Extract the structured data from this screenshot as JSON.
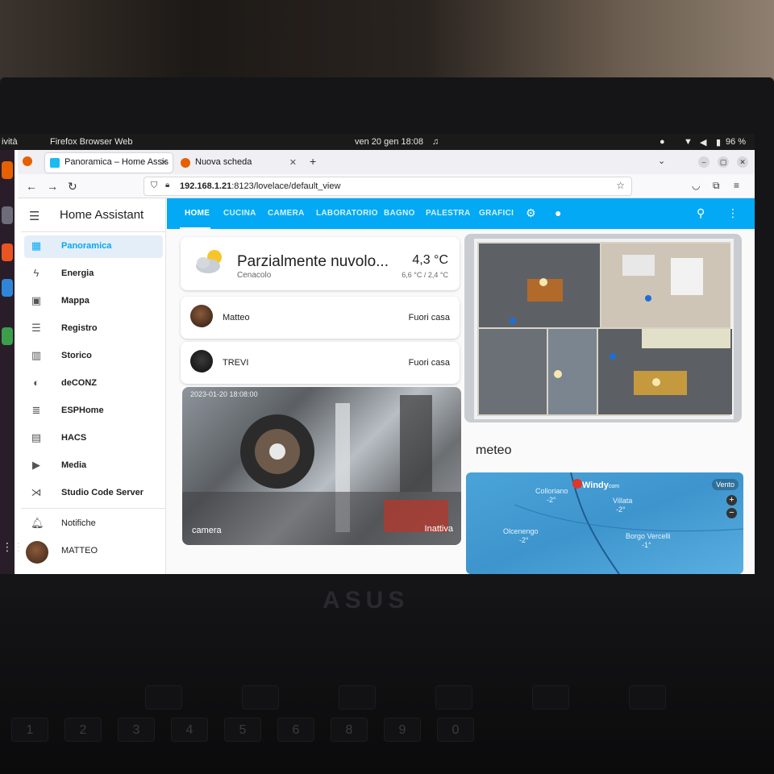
{
  "gnome": {
    "activities": "ività",
    "app_name": "Firefox Browser Web",
    "clock": "ven 20 gen  18:08",
    "battery": "96 %"
  },
  "browser": {
    "tabs": [
      {
        "label": "Panoramica – Home Assis",
        "active": true
      },
      {
        "label": "Nuova scheda",
        "active": false
      }
    ],
    "url_host": "192.168.1.21",
    "url_rest": ":8123/lovelace/default_view"
  },
  "ha": {
    "app_title": "Home Assistant",
    "sidebar": [
      {
        "label": "Panoramica",
        "icon": "dashboard-icon"
      },
      {
        "label": "Energia",
        "icon": "lightning-icon"
      },
      {
        "label": "Mappa",
        "icon": "map-icon"
      },
      {
        "label": "Registro",
        "icon": "list-icon"
      },
      {
        "label": "Storico",
        "icon": "chart-icon"
      },
      {
        "label": "deCONZ",
        "icon": "deconz-icon"
      },
      {
        "label": "ESPHome",
        "icon": "esphome-icon"
      },
      {
        "label": "HACS",
        "icon": "hacs-icon"
      },
      {
        "label": "Media",
        "icon": "media-icon"
      },
      {
        "label": "Studio Code Server",
        "icon": "vscode-icon"
      }
    ],
    "notifications_label": "Notifiche",
    "user_label": "MATTEO",
    "tabs": [
      "HOME",
      "CUCINA",
      "CAMERA",
      "LABORATORIO",
      "BAGNO",
      "PALESTRA",
      "GRAFICI"
    ],
    "weather": {
      "condition": "Parzialmente nuvolo...",
      "location": "Cenacolo",
      "temperature": "4,3 °C",
      "range": "6,6 °C / 2,4 °C"
    },
    "persons": [
      {
        "name": "Matteo",
        "state": "Fuori casa"
      },
      {
        "name": "TREVI",
        "state": "Fuori casa"
      }
    ],
    "camera": {
      "name": "camera",
      "state": "Inattiva",
      "stamp": "2023-01-20  18:08:00"
    },
    "meteo_title": "meteo",
    "map": {
      "brand": "Windy",
      "brand_suffix": "com",
      "layer": "Vento",
      "places": [
        {
          "name": "Colloriano",
          "value": "-2°"
        },
        {
          "name": "Villata",
          "value": "-2°"
        },
        {
          "name": "Olcenengo",
          "value": "-2°"
        },
        {
          "name": "Borgo Vercelli",
          "value": "-1°"
        }
      ]
    }
  }
}
